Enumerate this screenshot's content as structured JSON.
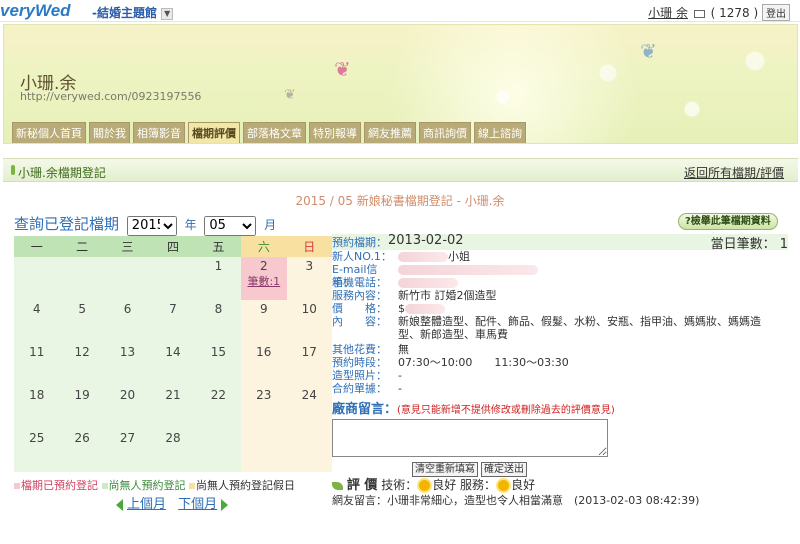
{
  "header": {
    "logo": "veryWed",
    "site_selector": "-結婚主題館",
    "user_name": "小珊 余",
    "mail_count": "( 1278 )",
    "logout_label": "登出"
  },
  "banner": {
    "owner_name": "小珊.余",
    "owner_url": "http://verywed.com/0923197556",
    "nav": [
      "新秘個人首頁",
      "關於我",
      "相簿影音",
      "檔期評價",
      "部落格文章",
      "特別報導",
      "網友推薦",
      "商訊詢價",
      "線上諮詢"
    ],
    "active_tab": "檔期評價"
  },
  "titlebar": {
    "title": "小珊.余檔期登記",
    "back_link": "返回所有檔期/評價"
  },
  "month_heading": "2015 / 05 新娘秘書檔期登記 - 小珊.余",
  "query": {
    "label": "查詢已登記檔期",
    "year": "2015",
    "year_suffix": "年",
    "month": "05",
    "month_suffix": "月",
    "print_button": "?檢舉此筆檔期資料"
  },
  "calendar": {
    "weekdays": [
      "一",
      "二",
      "三",
      "四",
      "五",
      "六",
      "日"
    ],
    "weeks": [
      [
        "",
        "",
        "",
        "",
        "1",
        "2",
        "3"
      ],
      [
        "4",
        "5",
        "6",
        "7",
        "8",
        "9",
        "10"
      ],
      [
        "11",
        "12",
        "13",
        "14",
        "15",
        "16",
        "17"
      ],
      [
        "18",
        "19",
        "20",
        "21",
        "22",
        "23",
        "24"
      ],
      [
        "25",
        "26",
        "27",
        "28",
        "",
        "",
        ""
      ]
    ],
    "booked_day": "2",
    "booked_count": "筆數:1"
  },
  "legend": {
    "booked": "檔期已預約登記",
    "open": "尚無人預約登記",
    "open_holiday": "尚無人預約登記假日"
  },
  "month_nav": {
    "prev": "上個月",
    "next": "下個月"
  },
  "detail": {
    "date_label": "預約檔期：",
    "date_value": "2013-02-02",
    "count_label": "當日筆數：",
    "count_value": "1",
    "bride_label": "新人NO.1：",
    "bride_value": "小姐",
    "email_label": "E-mail信箱：",
    "phone_label": "手機電話：",
    "service_label": "服務內容：",
    "service_value": "新竹市 訂婚2個造型",
    "price_label": "價　　格：",
    "price_value": "$",
    "content_label": "內　　容：",
    "content_value": "新娘整體造型、配件、飾品、假髮、水粉、安瓶、指甲油、媽媽妝、媽媽造型、新郎造型、車馬費",
    "other_label": "其他花費：",
    "other_value": "無",
    "time_label": "預約時段：",
    "time_value": "07:30～10:00　　11:30～03:30",
    "photo_label": "造型照片：",
    "photo_value": "-",
    "contract_label": "合約單據：",
    "contract_value": "-",
    "message_label": "廠商留言：",
    "message_note": "(意見只能新增不提供修改或刪除過去的評價意見)",
    "clear_button": "清空重新填寫",
    "submit_button": "確定送出"
  },
  "review": {
    "title": "評 價",
    "skill_label": "技術：",
    "skill_value": "良好",
    "service_label": "服務：",
    "service_value": "良好",
    "comment": "網友留言：小珊非常細心，造型也令人相當滿意　(2013-02-03 08:42:39)"
  }
}
